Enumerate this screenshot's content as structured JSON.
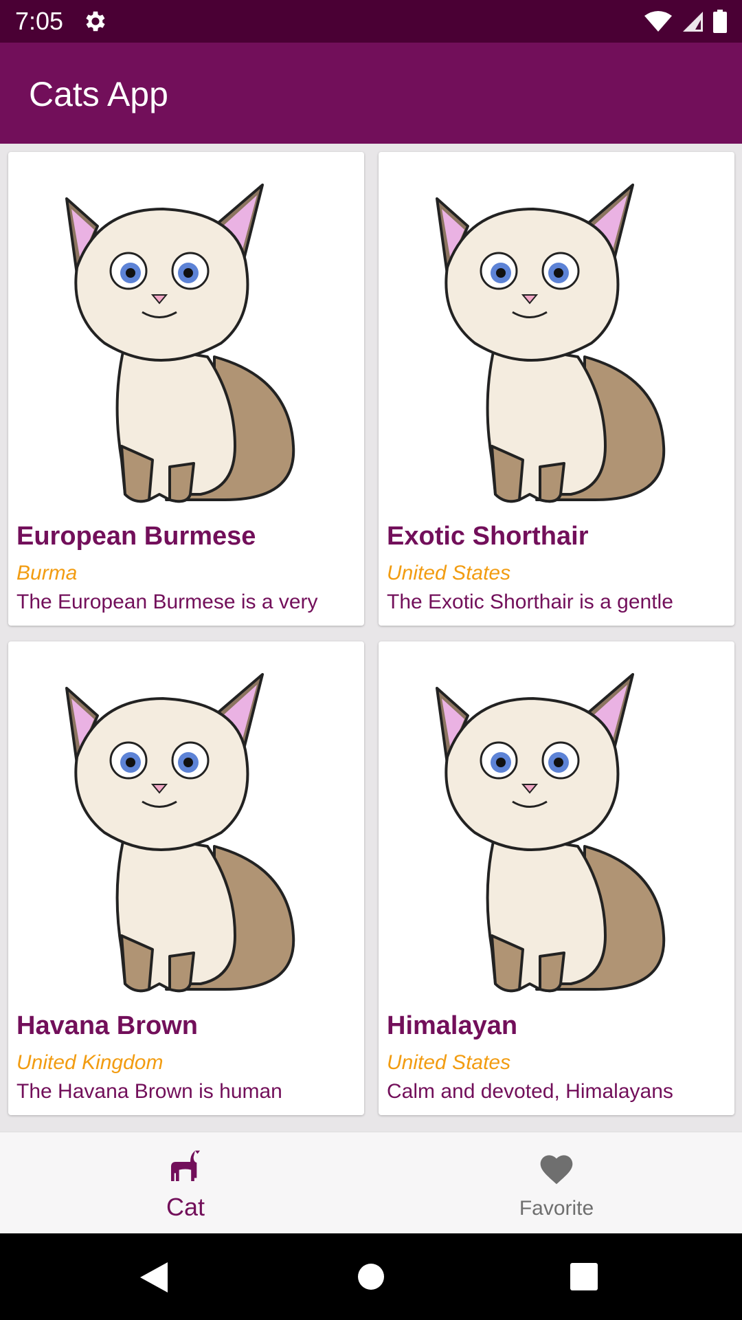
{
  "status_bar": {
    "time": "7:05",
    "icons": [
      "settings-icon",
      "wifi-icon",
      "signal-icon",
      "battery-icon"
    ]
  },
  "app_bar": {
    "title": "Cats App"
  },
  "cards": [
    {
      "name": "European Burmese",
      "origin": "Burma",
      "description": "The European Burmese is a very"
    },
    {
      "name": "Exotic Shorthair",
      "origin": "United States",
      "description": "The Exotic Shorthair is a gentle"
    },
    {
      "name": "Havana Brown",
      "origin": "United Kingdom",
      "description": "The Havana Brown is human"
    },
    {
      "name": "Himalayan",
      "origin": "United States",
      "description": "Calm and devoted, Himalayans"
    }
  ],
  "bottom_nav": {
    "items": [
      {
        "label": "Cat",
        "icon": "cat-icon",
        "selected": true
      },
      {
        "label": "Favorite",
        "icon": "heart-icon",
        "selected": false
      }
    ]
  },
  "system_nav": {
    "icons": [
      "back-icon",
      "home-icon",
      "recents-icon"
    ]
  },
  "colors": {
    "primary": "#720f5a",
    "primary_dark": "#4a0034",
    "accent": "#f29c11",
    "nav_inactive": "#6f6f6f"
  }
}
